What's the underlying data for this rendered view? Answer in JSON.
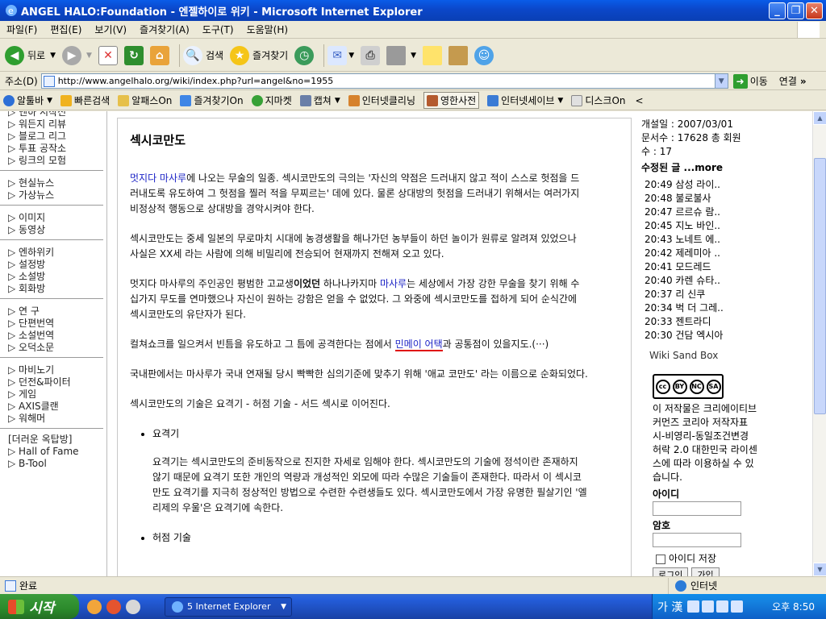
{
  "window": {
    "title": "ANGEL HALO:Foundation - 엔젤하이로 위키 - Microsoft Internet Explorer",
    "minimize": "_",
    "restore": "❐",
    "close": "✕"
  },
  "menu": [
    "파일(F)",
    "편집(E)",
    "보기(V)",
    "즐겨찾기(A)",
    "도구(T)",
    "도움말(H)"
  ],
  "toolbar": {
    "back": "뒤로",
    "search": "검색",
    "favorites": "즐겨찾기"
  },
  "address": {
    "label": "주소(D)",
    "url": "http://www.angelhalo.org/wiki/index.php?url=angel&no=1955",
    "go": "이동",
    "links": "연결"
  },
  "linkbar": [
    "알툴바",
    "빠른검색",
    "알패스On",
    "즐겨찾기On",
    "지마켓",
    "캡쳐",
    "인터넷클리닝",
    "영한사전",
    "인터넷세이브",
    "디스크On"
  ],
  "leftnav": {
    "groups": [
      [
        "엔하 시작전",
        "워든지 리뷰",
        "블로그 리그",
        "투표 공작소",
        "링크의 모험"
      ],
      [
        "현실뉴스",
        "가상뉴스"
      ],
      [
        "이미지",
        "동영상"
      ],
      [
        "엔하위키",
        "설정방",
        "소설방",
        "회화방"
      ],
      [
        "연 구",
        "단편번역",
        "소설번역",
        "오덕소문"
      ],
      [
        "마비노기",
        "던전&파이터",
        "게임",
        "AXIS클랜",
        "워해머"
      ]
    ],
    "extra_title": "[더러운 옥탑방]",
    "extra": [
      "Hall of Fame",
      "B-Tool"
    ]
  },
  "article": {
    "title": "섹시코만도",
    "p1_link": "멋지다 마사루",
    "p1_text": "에 나오는 무술의 일종. 섹시코만도의 극의는 '자신의 약점은 드러내지 않고 적이 스스로 헛점을 드러내도록 유도하여 그 헛점을 찔러 적을 무찌르는' 데에 있다. 물론 상대방의 헛점을 드러내기 위해서는 여러가지 비정상적 행동으로 상대방을 경악시켜야 한다.",
    "p2": "섹시코만도는 중세 일본의 무로마치 시대에 농경생활을 해나가던 농부들이 하던 놀이가 원류로 알려져 있었으나 사실은 XX세 라는 사람에 의해 비밀리에 전승되어 현재까지 전해져 오고 있다.",
    "p3_a": "멋지다 마사루의 주인공인 평범한 고교생",
    "p3_b": "이었던",
    "p3_c": " 하나나카지마 ",
    "p3_link": "마사루",
    "p3_d": "는 세상에서 가장 강한 무술을 찾기 위해 수십가지 무도를 연마했으나 자신이 원하는 강함은 얻을 수 없었다. 그 와중에 섹시코만도를 접하게 되어 순식간에 섹시코만도의 유단자가 된다.",
    "p4_a": "컬쳐쇼크를 일으켜서 빈틈을 유도하고 그 틈에 공격한다는 점에서 ",
    "p4_link": "민메이 어택",
    "p4_b": "과 공통점이 있을지도.(···)",
    "p5": "국내판에서는 마사루가 국내 연재될 당시 빡빡한 심의기준에 맞추기 위해 '애교 코만도' 라는 이름으로 순화되었다.",
    "p6": "섹시코만도의 기술은 요격기 - 허점 기술 - 서드 섹시로 이어진다.",
    "li1": "요격기",
    "li1_text": "요격기는 섹시코만도의 준비동작으로 진지한 자세로 임해야 한다. 섹시코만도의 기술에 정석이란 존재하지 않기    때문에 요격기 또한 개인의 역량과 개성적인 외모에 따라 수많은 기술들이 존재한다. 따라서 이 섹시코만도 요격기를 지극히 정상적인 방법으로 수련한 수련생들도 있다. 섹시코만도에서 가장 유명한 필살기인 '엘리제의 우울'은 요격기에 속한다.",
    "li2": "허점 기술"
  },
  "rightbar": {
    "opened": "개설일 : 2007/03/01",
    "docs": "문서수 : 17628 총 회원",
    "members": "수 : 17",
    "recent_title": "수정된 글 ...more",
    "recent": [
      "20:49  삼성 라이..",
      "20:48  불로불사",
      "20:47  르르슈 람..",
      "20:45  지노 바인..",
      "20:43  노네트 에..",
      "20:42  제레미아 ..",
      "20:41  모드레드",
      "20:40  카렌 슈타..",
      "20:37  리 신쿠",
      "20:34  벅 더 그레..",
      "20:33  젠트라디",
      "20:30  건담 엑시아"
    ],
    "sandbox": "Wiki Sand Box",
    "cc": [
      "cc",
      "BY",
      "NC",
      "SA"
    ],
    "license": "이 저작물은 크리에이티브 커먼즈 코리아 저작자표시-비영리-동일조건변경허락 2.0 대한민국 라이센스에 따라 이용하실 수 있습니다.",
    "id_label": "아이디",
    "pw_label": "암호",
    "save_id": "아이디 저장",
    "login": "로그인",
    "join": "가입"
  },
  "status": {
    "text": "완료",
    "zone": "인터넷"
  },
  "taskbar": {
    "start": "시작",
    "task": "5 Internet Explorer",
    "lang": "가 漢",
    "clock": "오후 8:50"
  }
}
